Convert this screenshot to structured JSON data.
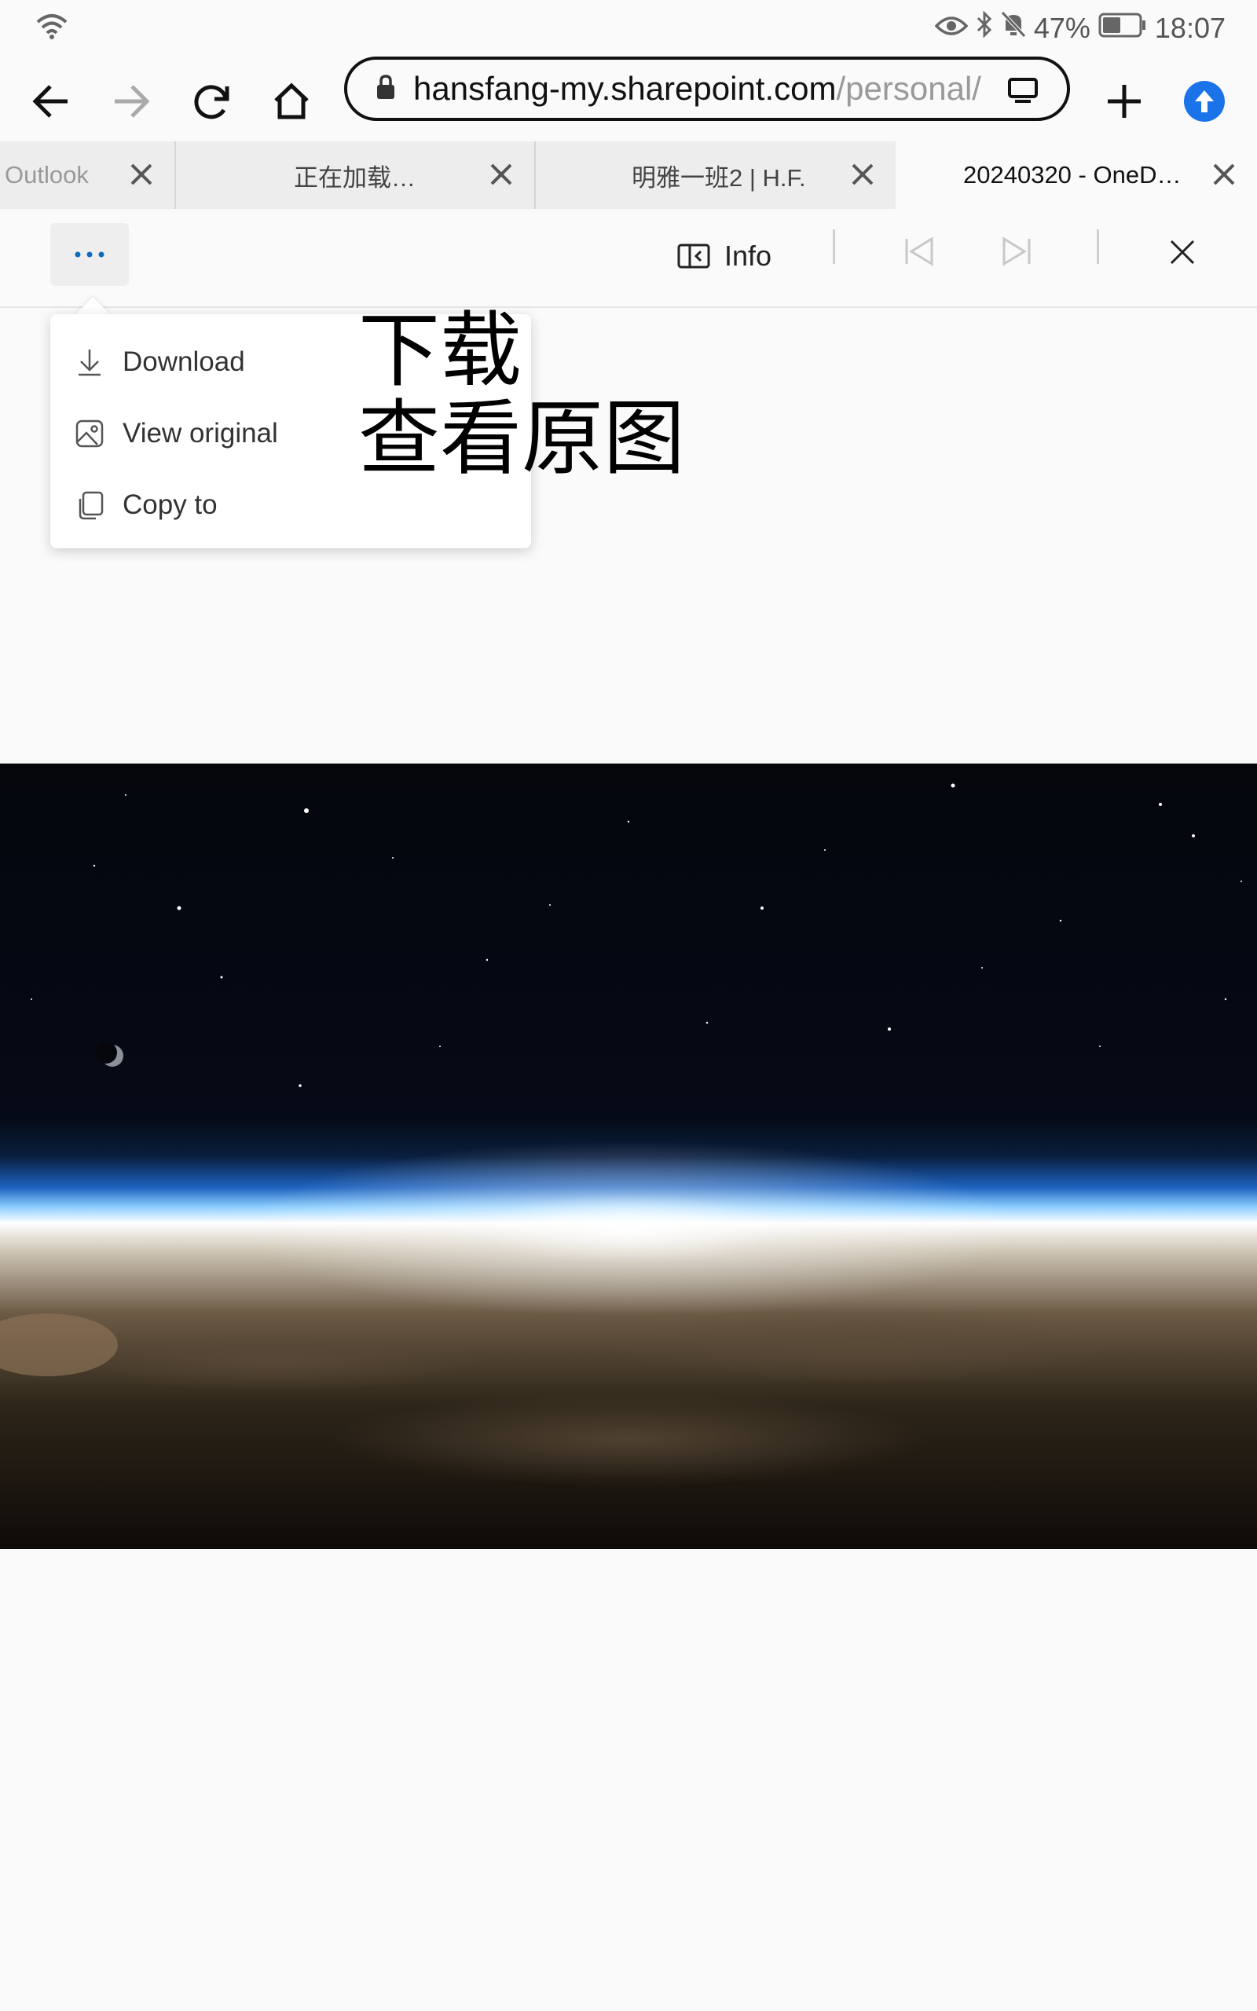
{
  "status_bar": {
    "battery": "47%",
    "time": "18:07"
  },
  "browser": {
    "url_host": "hansfang-my.sharepoint.com",
    "url_path": "/personal/",
    "tabs": [
      {
        "label": "Outlook"
      },
      {
        "label": "正在加载…"
      },
      {
        "label": "明雅一班2 | H.F."
      },
      {
        "label": "20240320 - OneD…"
      }
    ]
  },
  "viewer": {
    "more_label": "···",
    "info_label": "Info"
  },
  "menu": {
    "items": [
      {
        "label": "Download",
        "icon": "download-icon"
      },
      {
        "label": "View original",
        "icon": "image-icon"
      },
      {
        "label": "Copy to",
        "icon": "copy-icon"
      }
    ]
  },
  "annotation": {
    "line1": "下载",
    "line2": "查看原图"
  },
  "colors": {
    "accent": "#0f6cbd",
    "upload": "#1a73e8",
    "page_bg": "#fafafa"
  }
}
